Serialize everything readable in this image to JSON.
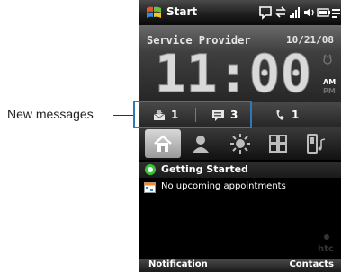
{
  "callout": {
    "label": "New messages"
  },
  "status_bar": {
    "start_label": "Start",
    "icons": [
      "windows-flag-icon",
      "speech-bubble-icon",
      "data-sync-icon",
      "signal-icon",
      "volume-icon",
      "battery-icon",
      "menu-lines-icon"
    ]
  },
  "clock_panel": {
    "provider": "Service Provider",
    "date": "10/21/08",
    "time": "11:00",
    "am_label": "AM",
    "pm_label": "PM"
  },
  "notifications": {
    "messages_count": "1",
    "emails_count": "3",
    "calls_count": "1"
  },
  "tabs": [
    {
      "name": "home",
      "active": true
    },
    {
      "name": "people",
      "active": false
    },
    {
      "name": "weather",
      "active": false
    },
    {
      "name": "apps",
      "active": false
    },
    {
      "name": "music",
      "active": false
    }
  ],
  "content": {
    "getting_started": "Getting Started",
    "appointments": "No upcoming appointments",
    "watermark": "htc"
  },
  "softkeys": {
    "left": "Notification",
    "right": "Contacts"
  },
  "colors": {
    "highlight": "#2f78b8",
    "accent_green": "#3fbf3f"
  }
}
